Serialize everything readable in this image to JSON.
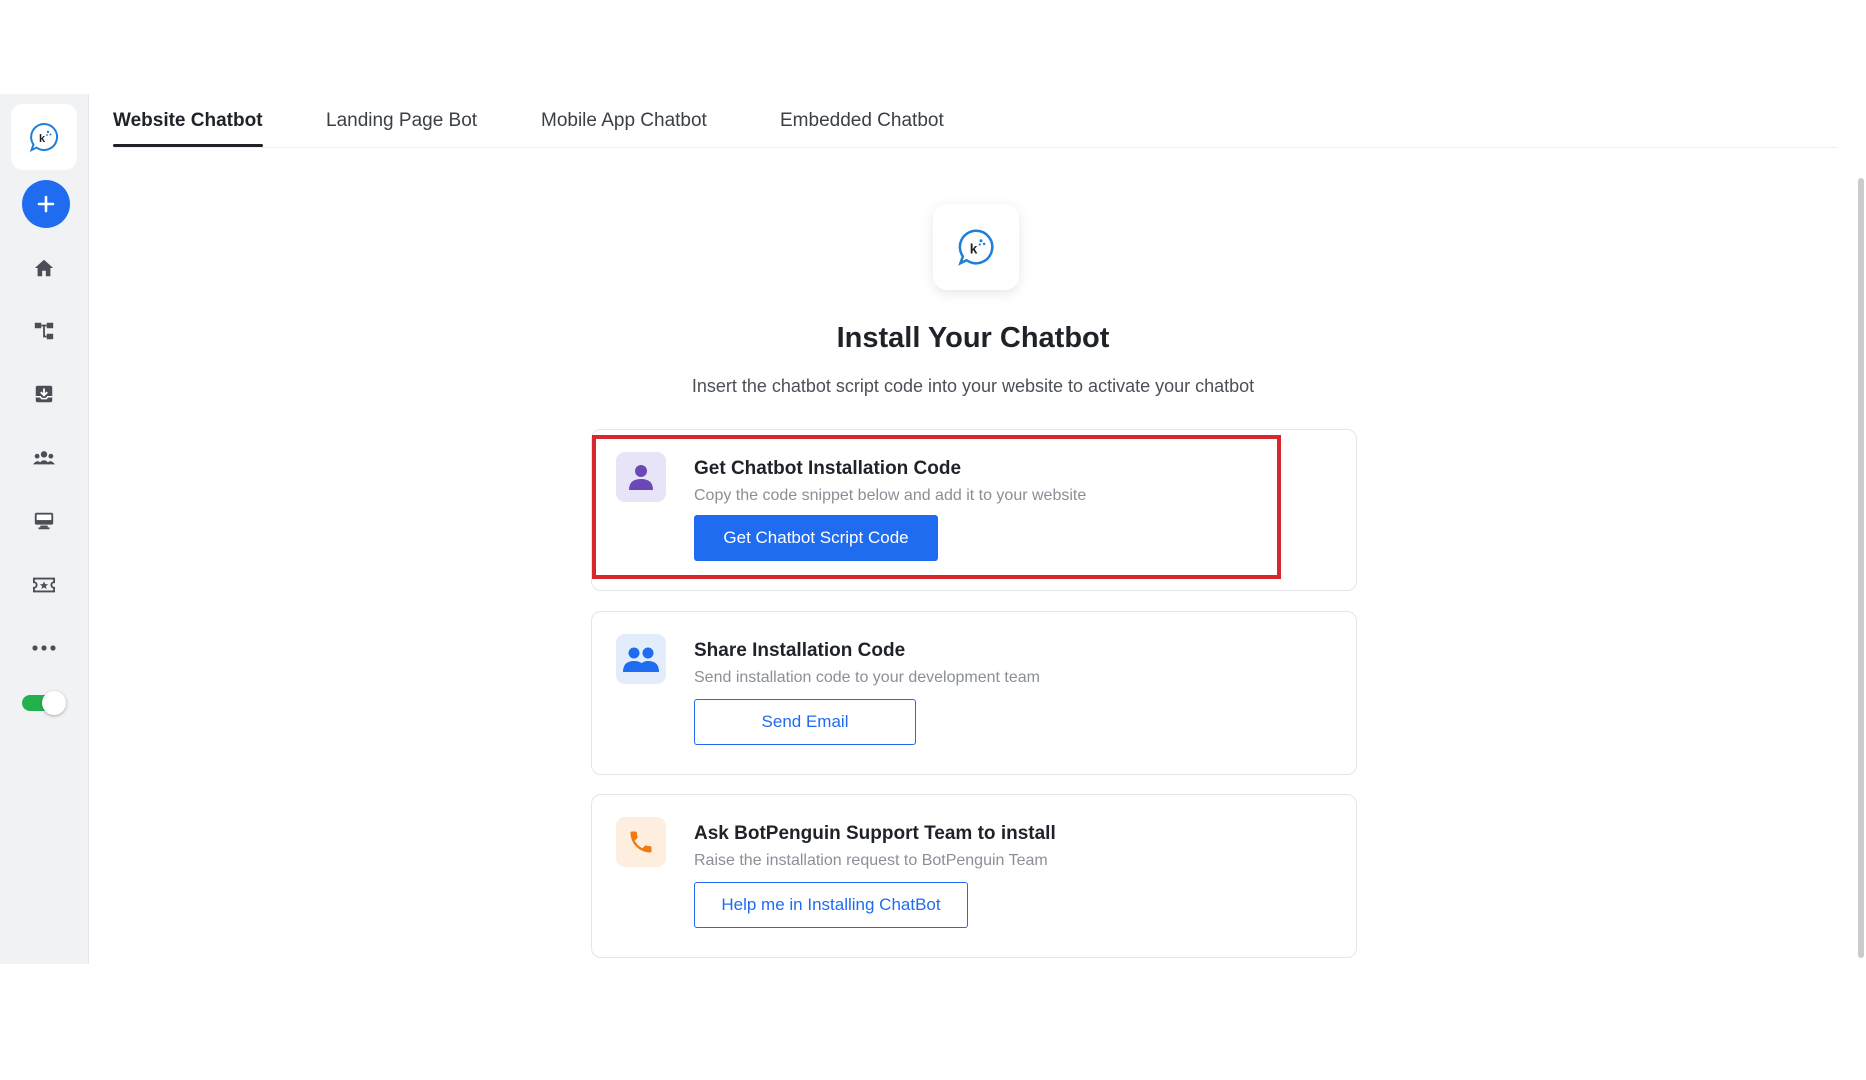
{
  "tabs": [
    {
      "label": "Website Chatbot",
      "active": true
    },
    {
      "label": "Landing Page Bot",
      "active": false
    },
    {
      "label": "Mobile App Chatbot",
      "active": false
    },
    {
      "label": "Embedded Chatbot",
      "active": false
    }
  ],
  "sidebar": {
    "items": [
      {
        "icon": "home-icon"
      },
      {
        "icon": "flow-builder-icon"
      },
      {
        "icon": "inbox-icon"
      },
      {
        "icon": "users-icon"
      },
      {
        "icon": "monitor-icon"
      },
      {
        "icon": "ticket-icon"
      },
      {
        "icon": "more-icon"
      }
    ],
    "toggle_on": true
  },
  "main": {
    "title": "Install Your Chatbot",
    "subtitle": "Insert the chatbot script code into your website to activate your chatbot",
    "cards": [
      {
        "icon": "person-icon",
        "title": "Get Chatbot Installation Code",
        "description": "Copy the code snippet below and add it to your website",
        "button_label": "Get Chatbot Script Code"
      },
      {
        "icon": "team-icon",
        "title": "Share Installation Code",
        "description": "Send installation code to your development team",
        "button_label": "Send Email"
      },
      {
        "icon": "phone-icon",
        "title": "Ask BotPenguin Support Team to install",
        "description": "Raise the installation request to BotPenguin Team",
        "button_label": "Help me in Installing ChatBot"
      }
    ]
  },
  "colors": {
    "primary": "#1f6cf0",
    "highlight": "#d6262e",
    "toggle": "#22b14c"
  }
}
